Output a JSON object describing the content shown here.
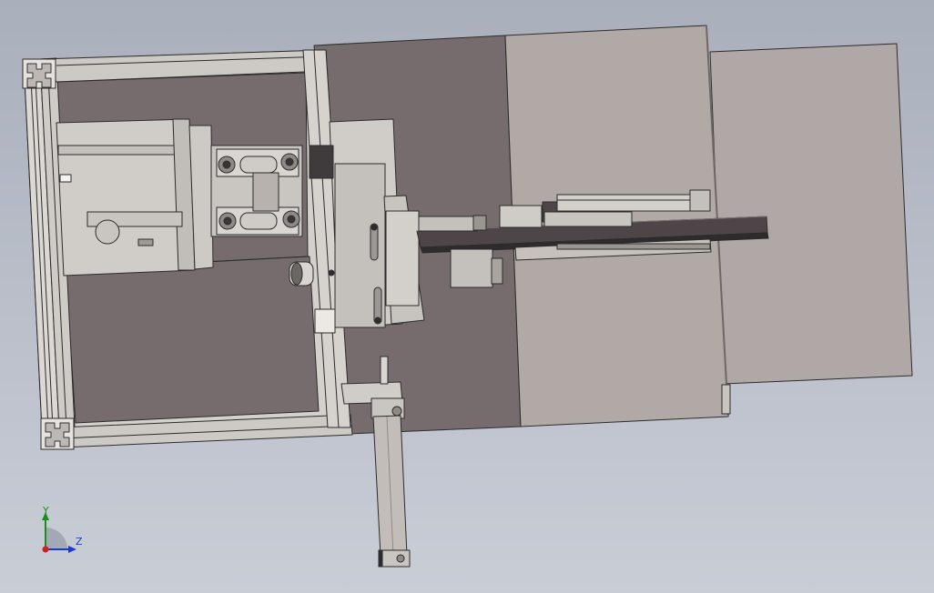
{
  "viewport": {
    "background_top": "#a9afbb",
    "background_bottom": "#c9cdd6"
  },
  "model": {
    "type": "3D CAD assembly, shaded with edges",
    "colors": {
      "base_plate_dark": "#766c6e",
      "base_plate_light": "#b1a9a6",
      "extension_plate": "#b0a8a6",
      "frame_aluminum": "#d4d0cc",
      "edge_line": "#2c2c2c",
      "rail_dark": "#4d4548",
      "block_light": "#c4c0bb"
    }
  },
  "triad": {
    "y_label": "Y",
    "z_label": "Z",
    "y_color": "#1a8f1a",
    "z_color": "#1a3bd6",
    "x_color": "#d41e1e"
  }
}
